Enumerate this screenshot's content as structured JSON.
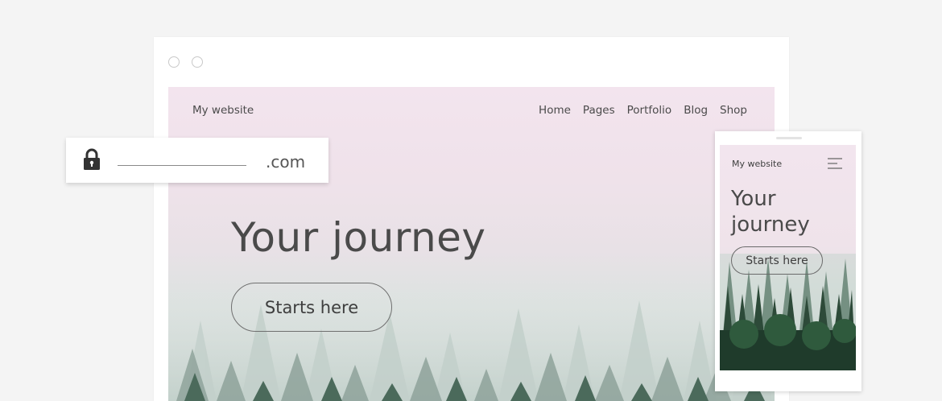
{
  "browser": {
    "window_buttons": [
      "window-button",
      "window-button"
    ]
  },
  "site": {
    "title": "My website",
    "nav": [
      "Home",
      "Pages",
      "Portfolio",
      "Blog",
      "Shop"
    ],
    "hero_title": "Your journey",
    "hero_button": "Starts here"
  },
  "urlbar": {
    "icon": "lock-icon",
    "domain_suffix": ".com"
  },
  "mobile": {
    "title": "My website",
    "menu_icon": "hamburger-menu-icon",
    "hero_line1": "Your",
    "hero_line2": "journey",
    "hero_button": "Starts here"
  },
  "colors": {
    "hero_top": "#f3e4ee",
    "hero_bottom": "#d2ddd9",
    "forest_dark": "#1f3b2b",
    "text": "#4a4a4a"
  }
}
